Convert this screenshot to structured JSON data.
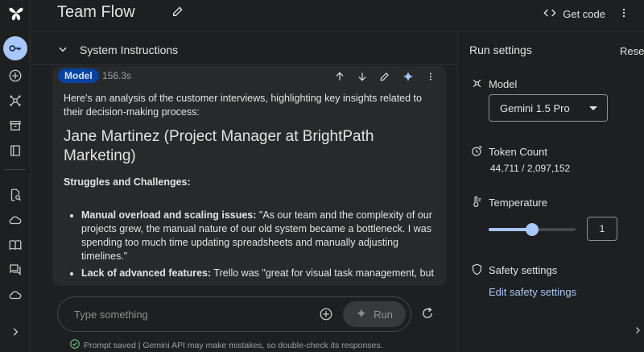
{
  "header": {
    "title": "Team Flow",
    "get_code": "Get code"
  },
  "system_instructions": {
    "label": "System Instructions"
  },
  "message": {
    "role": "Model",
    "duration": "156.3s",
    "intro": "Here's an analysis of the customer interviews, highlighting key insights related to their decision-making process:",
    "heading": "Jane Martinez (Project Manager at BrightPath Marketing)",
    "subheading": "Struggles and Challenges:",
    "bullets": [
      {
        "bold": "Manual overload and scaling issues:",
        "text": " \"As our team and the complexity of our projects grew, the manual nature of our old system became a bottleneck. I was spending too much time updating spreadsheets and manually adjusting timelines.\""
      },
      {
        "bold": "Lack of advanced features:",
        "text": " Trello was \"great for visual task management, but"
      }
    ]
  },
  "composer": {
    "placeholder": "Type something",
    "run_label": "Run"
  },
  "footer": {
    "saved_text": "Prompt saved | Gemini API may make mistakes, so double-check its responses."
  },
  "run_settings": {
    "title": "Run settings",
    "reset": "Reset",
    "model_label": "Model",
    "model_value": "Gemini 1.5 Pro",
    "token_label": "Token Count",
    "token_value": "44,711 / 2,097,152",
    "temperature_label": "Temperature",
    "temperature_value": "1",
    "temperature_fraction": 0.5,
    "safety_label": "Safety settings",
    "safety_link": "Edit safety settings"
  },
  "colors": {
    "accent": "#a8c7fa",
    "badge_bg": "#0842a0",
    "background": "#1e1f20"
  },
  "icons": {
    "rail": [
      "logo-icon",
      "key-icon",
      "add-circle-icon",
      "tune-icon",
      "archive-icon",
      "book-icon",
      "doc-search-icon",
      "cloud-icon",
      "menu-book-icon",
      "forum-icon",
      "cloud-done-icon",
      "chevron-right-icon"
    ]
  }
}
